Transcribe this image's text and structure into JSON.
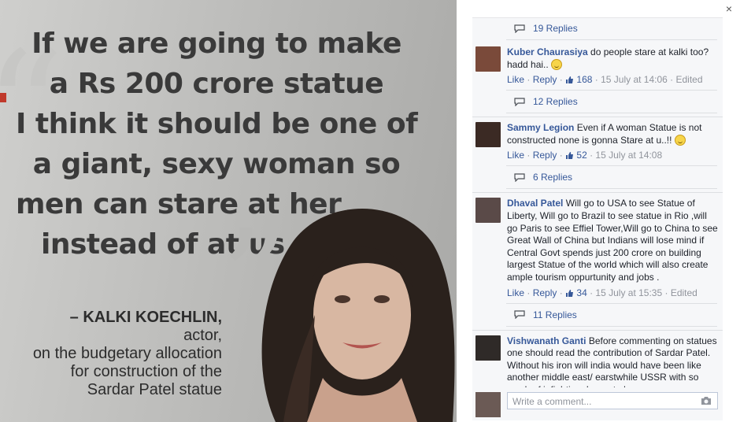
{
  "photo": {
    "quote_lines": [
      "If we are going to make",
      "a Rs 200 crore statue",
      "I think it should be one of",
      "a giant, sexy woman so",
      "men can stare at her",
      "instead of at us"
    ],
    "attribution_name": "– KALKI KOECHLIN,",
    "attribution_lines": [
      "actor,",
      "on the budgetary allocation",
      "for construction of the",
      "Sardar Patel statue"
    ]
  },
  "panel": {
    "close_label": "×",
    "top_replies": "19 Replies",
    "comments": [
      {
        "author": "Kuber Chaurasiya",
        "text": "do people stare at kalki too? hadd hai..",
        "emoji": true,
        "like": "Like",
        "reply": "Reply",
        "likes": "168",
        "time": "15 July at 14:06",
        "edited": "Edited",
        "replies": "12 Replies",
        "avatar_color": "#7a4a3a"
      },
      {
        "author": "Sammy Legion",
        "text": "Even if A woman Statue is not constructed none is gonna Stare at u..!!",
        "emoji": true,
        "like": "Like",
        "reply": "Reply",
        "likes": "52",
        "time": "15 July at 14:08",
        "edited": "",
        "replies": "6 Replies",
        "avatar_color": "#3b2a24"
      },
      {
        "author": "Dhaval Patel",
        "text": "Will go to USA to see Statue of Liberty, Will go to Brazil to see statue in Rio ,will go Paris to see Effiel Tower,Will go to China to see Great Wall of China but Indians will lose mind if Central Govt spends just 200 crore on building largest Statue of the world which will also create ample tourism oppurtunity and jobs .",
        "emoji": false,
        "like": "Like",
        "reply": "Reply",
        "likes": "34",
        "time": "15 July at 15:35",
        "edited": "Edited",
        "replies": "11 Replies",
        "avatar_color": "#5a4a48"
      },
      {
        "author": "Vishwanath Ganti",
        "text": "Before commenting on statues one should read the contribution of Sardar Patel. Without his iron will india would have been like another middle east/ earstwhile USSR with so much of infighting. Learn to be",
        "emoji": false,
        "like": "",
        "reply": "",
        "likes": "",
        "time": "",
        "edited": "",
        "replies": "",
        "avatar_color": "#2f2a28"
      }
    ],
    "composer_placeholder": "Write a comment..."
  },
  "colors": {
    "link": "#365899",
    "meta": "#90949c",
    "panel_bg": "#f6f7f9"
  }
}
